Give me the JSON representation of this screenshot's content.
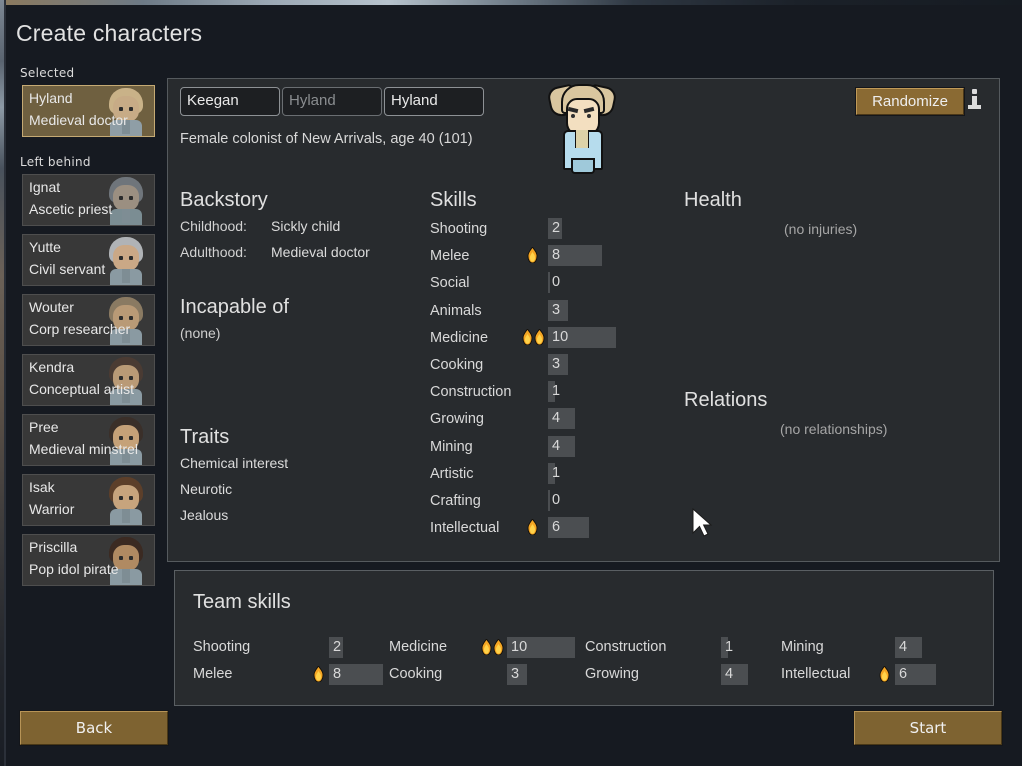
{
  "page_title": "Create characters",
  "sidebar": {
    "selected_label": "Selected",
    "left_behind_label": "Left behind",
    "selected": [
      {
        "name": "Hyland",
        "title": "Medieval doctor",
        "hair": "#c9b288",
        "skin": "#c7ab86",
        "body": "#8f9ea6"
      }
    ],
    "left_behind": [
      {
        "name": "Ignat",
        "title": "Ascetic priest",
        "hair": "#6f757b",
        "skin": "#9b8f81",
        "body": "#7b8d93"
      },
      {
        "name": "Yutte",
        "title": "Civil servant",
        "hair": "#b0b3b6",
        "skin": "#caa886",
        "body": "#8a9aa2"
      },
      {
        "name": "Wouter",
        "title": "Corp researcher",
        "hair": "#8a7a62",
        "skin": "#b99a76",
        "body": "#8a9aa2"
      },
      {
        "name": "Kendra",
        "title": "Conceptual artist",
        "hair": "#4a3b33",
        "skin": "#b99a76",
        "body": "#8a9aa2"
      },
      {
        "name": "Pree",
        "title": "Medieval minstrel",
        "hair": "#3a2f29",
        "skin": "#c5a178",
        "body": "#8a9aa2"
      },
      {
        "name": "Isak",
        "title": "Warrior",
        "hair": "#5c3f2a",
        "skin": "#c7a47d",
        "body": "#8a9aa2"
      },
      {
        "name": "Priscilla",
        "title": "Pop idol pirate",
        "hair": "#3b2a22",
        "skin": "#b08a62",
        "body": "#8a9aa2"
      }
    ]
  },
  "character": {
    "first_name": "Keegan",
    "nick_name": "Hyland",
    "last_name": "Hyland",
    "description": "Female colonist of New Arrivals, age 40 (101)",
    "randomize_label": "Randomize",
    "info_icon": "info-icon"
  },
  "backstory": {
    "header": "Backstory",
    "childhood_label": "Childhood:",
    "childhood_value": "Sickly child",
    "adulthood_label": "Adulthood:",
    "adulthood_value": "Medieval doctor"
  },
  "incapable": {
    "header": "Incapable of",
    "value": "(none)"
  },
  "traits": {
    "header": "Traits",
    "items": [
      "Chemical interest",
      "Neurotic",
      "Jealous"
    ]
  },
  "skills": {
    "header": "Skills",
    "max": 20,
    "items": [
      {
        "name": "Shooting",
        "value": 2,
        "passion": 0
      },
      {
        "name": "Melee",
        "value": 8,
        "passion": 1
      },
      {
        "name": "Social",
        "value": 0,
        "passion": 0
      },
      {
        "name": "Animals",
        "value": 3,
        "passion": 0
      },
      {
        "name": "Medicine",
        "value": 10,
        "passion": 2
      },
      {
        "name": "Cooking",
        "value": 3,
        "passion": 0
      },
      {
        "name": "Construction",
        "value": 1,
        "passion": 0
      },
      {
        "name": "Growing",
        "value": 4,
        "passion": 0
      },
      {
        "name": "Mining",
        "value": 4,
        "passion": 0
      },
      {
        "name": "Artistic",
        "value": 1,
        "passion": 0
      },
      {
        "name": "Crafting",
        "value": 0,
        "passion": 0
      },
      {
        "name": "Intellectual",
        "value": 6,
        "passion": 1
      }
    ]
  },
  "health": {
    "header": "Health",
    "value": "(no injuries)"
  },
  "relations": {
    "header": "Relations",
    "value": "(no relationships)"
  },
  "team_skills": {
    "header": "Team skills",
    "columns": [
      [
        {
          "name": "Shooting",
          "value": 2,
          "passion": 0
        },
        {
          "name": "Melee",
          "value": 8,
          "passion": 1
        }
      ],
      [
        {
          "name": "Medicine",
          "value": 10,
          "passion": 2
        },
        {
          "name": "Cooking",
          "value": 3,
          "passion": 0
        }
      ],
      [
        {
          "name": "Construction",
          "value": 1,
          "passion": 0
        },
        {
          "name": "Growing",
          "value": 4,
          "passion": 0
        }
      ],
      [
        {
          "name": "Mining",
          "value": 4,
          "passion": 0
        },
        {
          "name": "Intellectual",
          "value": 6,
          "passion": 1
        }
      ]
    ]
  },
  "footer": {
    "back_label": "Back",
    "start_label": "Start"
  },
  "colors": {
    "accent_button": "#8a6a33",
    "selected_card": "#6f6040",
    "panel_bg": "#282b2e",
    "page_bg": "#161a21",
    "passion_flame": "#f0a020"
  }
}
